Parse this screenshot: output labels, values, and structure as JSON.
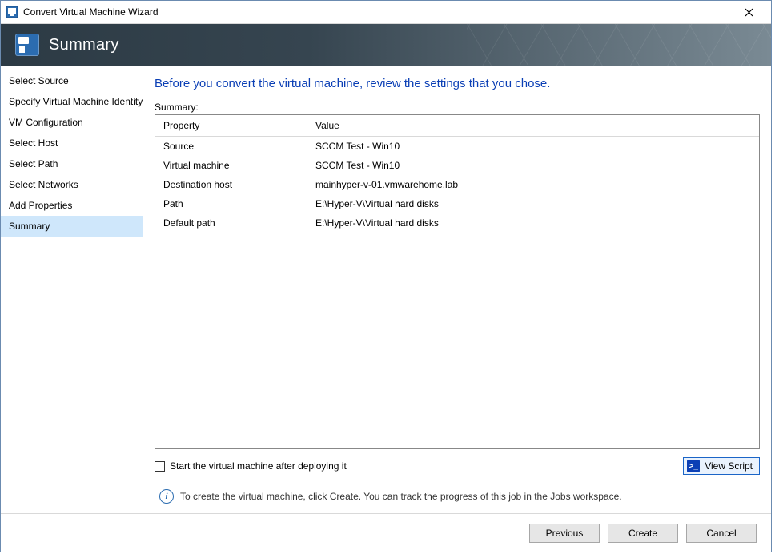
{
  "window": {
    "title": "Convert Virtual Machine Wizard"
  },
  "banner": {
    "title": "Summary"
  },
  "sidebar": {
    "items": [
      {
        "label": "Select Source"
      },
      {
        "label": "Specify Virtual Machine Identity"
      },
      {
        "label": "VM Configuration"
      },
      {
        "label": "Select Host"
      },
      {
        "label": "Select Path"
      },
      {
        "label": "Select Networks"
      },
      {
        "label": "Add Properties"
      },
      {
        "label": "Summary"
      }
    ],
    "selected_index": 7
  },
  "main": {
    "instruction": "Before you convert the virtual machine, review the settings that you chose.",
    "summary_label": "Summary:",
    "headers": {
      "property": "Property",
      "value": "Value"
    },
    "rows": [
      {
        "property": "Source",
        "value": "SCCM Test - Win10"
      },
      {
        "property": "Virtual machine",
        "value": "SCCM Test - Win10"
      },
      {
        "property": "Destination host",
        "value": "mainhyper-v-01.vmwarehome.lab"
      },
      {
        "property": "Path",
        "value": "E:\\Hyper-V\\Virtual hard disks"
      },
      {
        "property": "Default path",
        "value": "E:\\Hyper-V\\Virtual hard disks"
      }
    ],
    "start_vm_checkbox_label": "Start the virtual machine after deploying it",
    "start_vm_checked": false,
    "view_script_label": "View Script",
    "info_text": "To create the virtual machine, click Create.  You can track the progress of this job in the Jobs workspace."
  },
  "footer": {
    "previous": "Previous",
    "create": "Create",
    "cancel": "Cancel"
  }
}
